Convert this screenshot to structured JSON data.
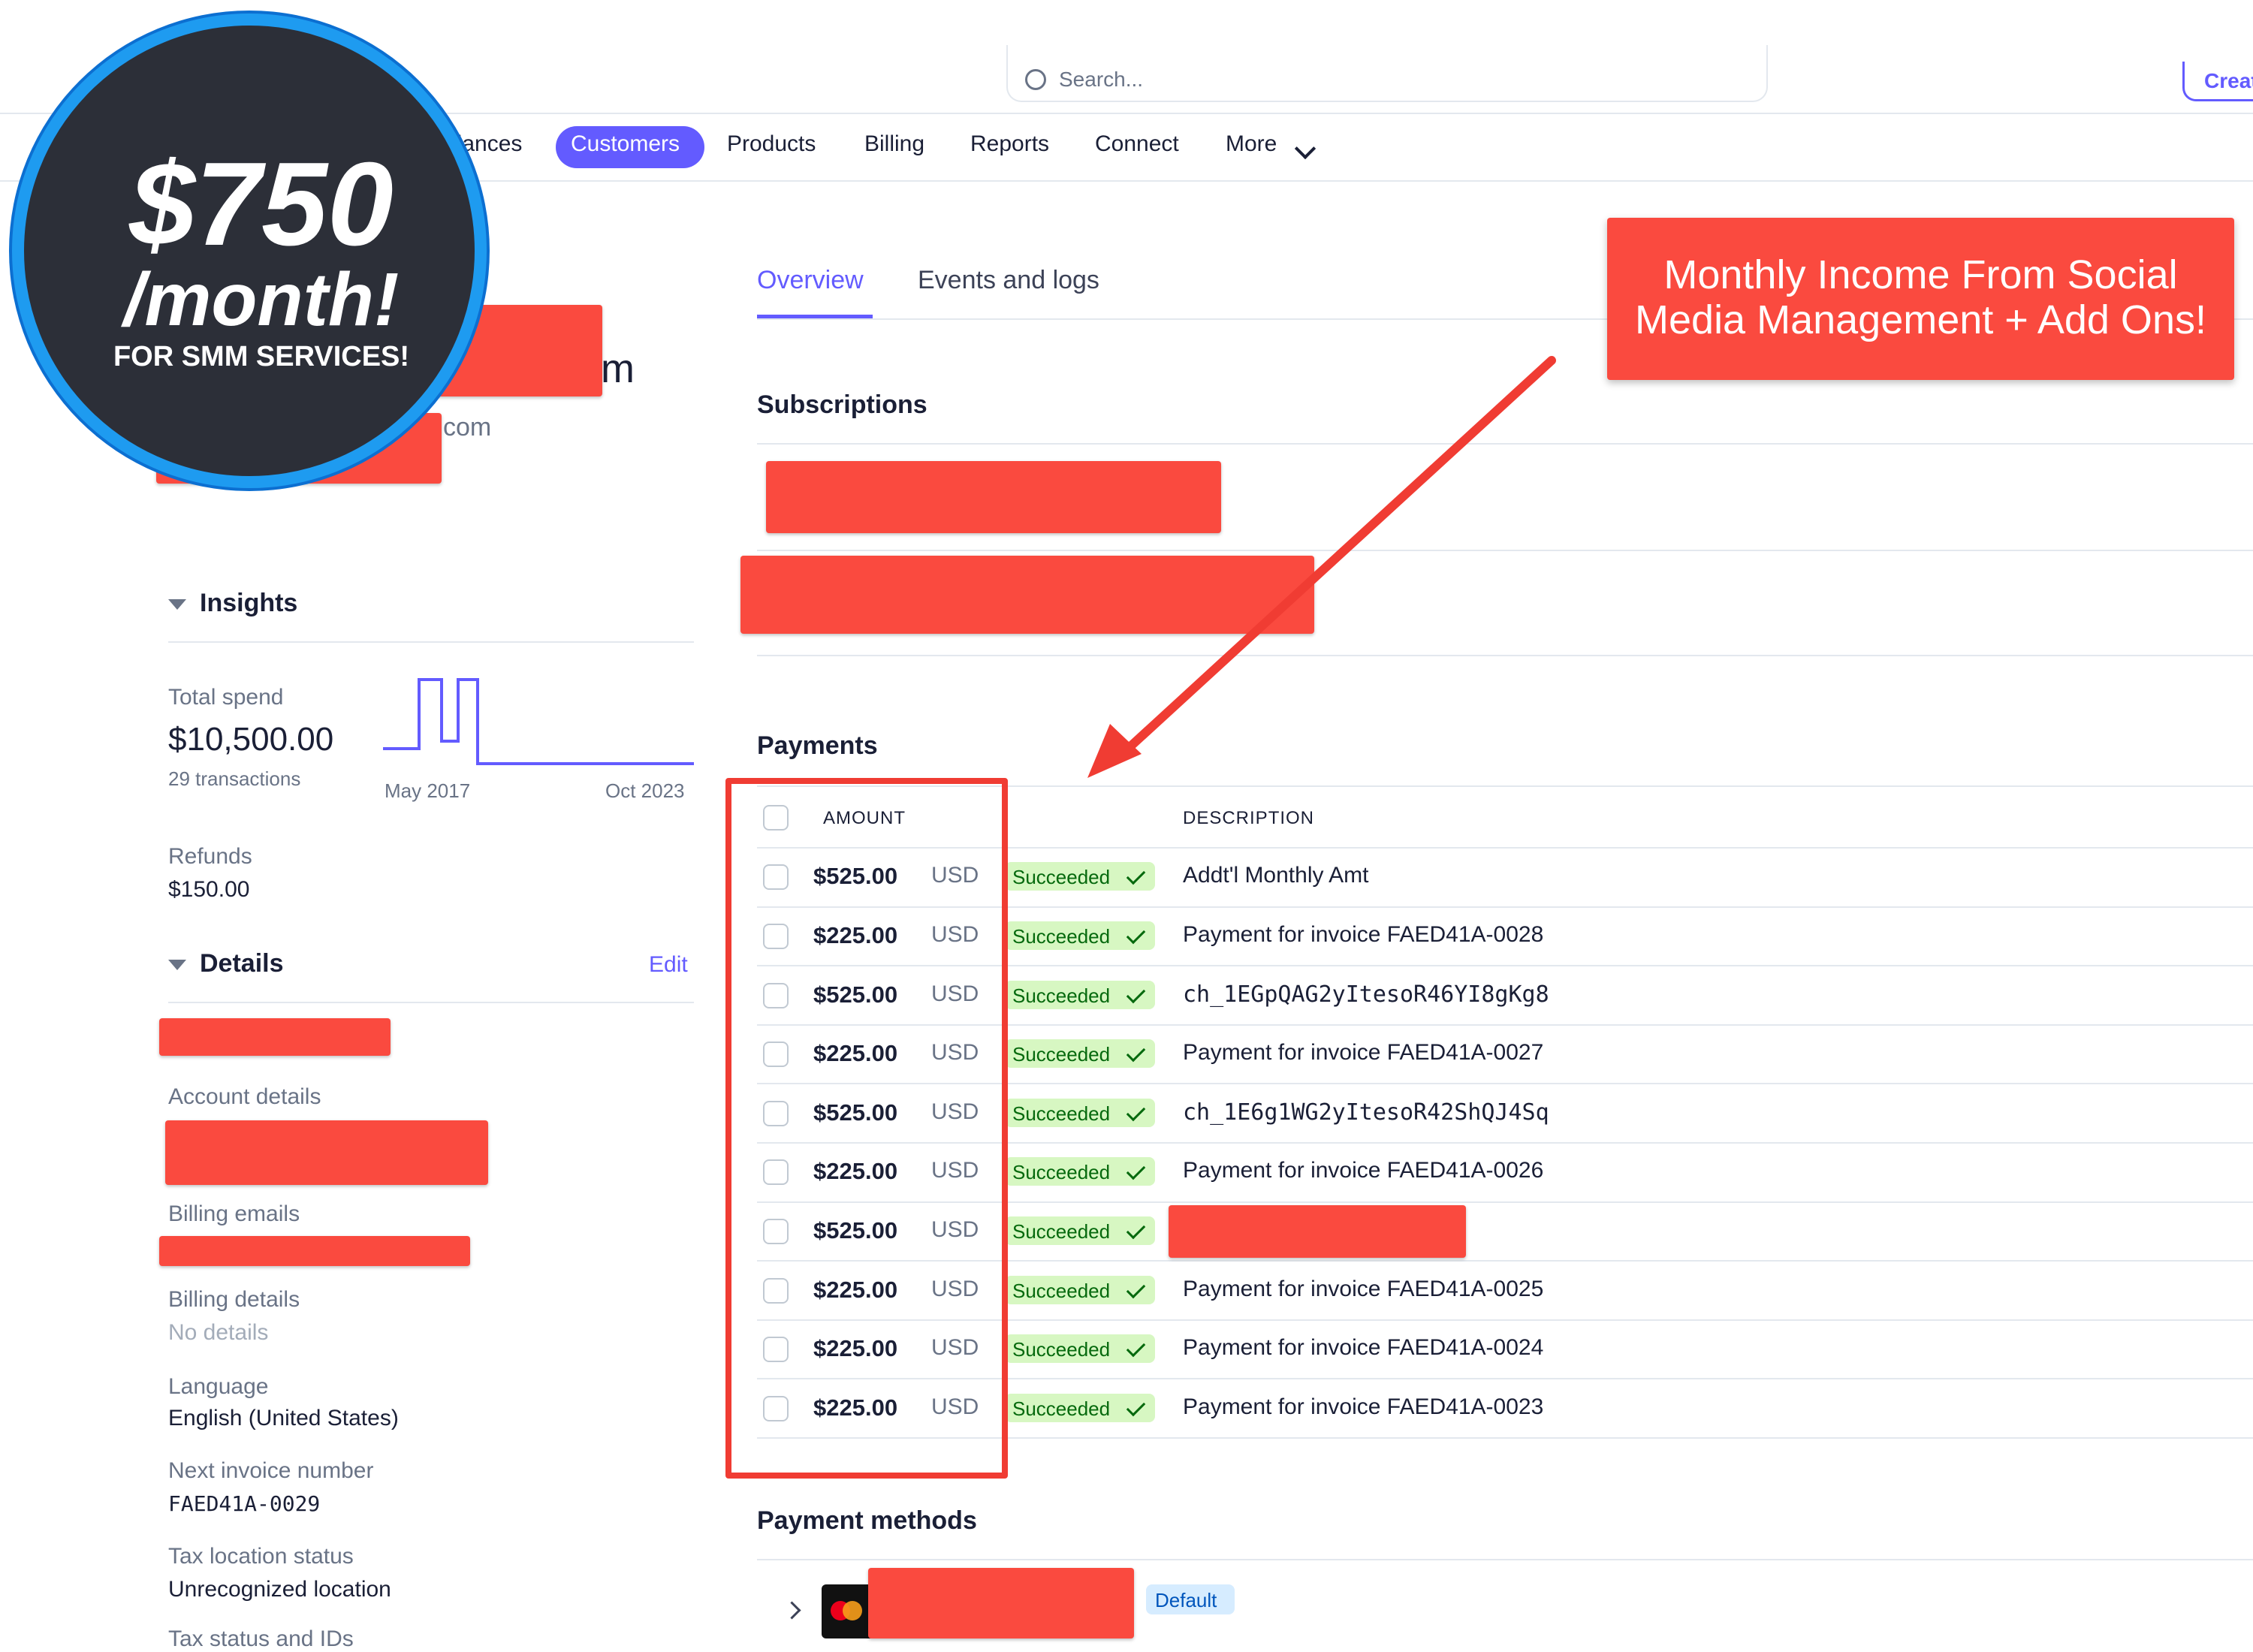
{
  "search": {
    "placeholder": "Search..."
  },
  "header": {
    "create_label": "Creat"
  },
  "nav": {
    "items": [
      {
        "label": "alances"
      },
      {
        "label": "Customers"
      },
      {
        "label": "Products"
      },
      {
        "label": "Billing"
      },
      {
        "label": "Reports"
      },
      {
        "label": "Connect"
      },
      {
        "label": "More"
      }
    ]
  },
  "promo": {
    "price": "$750",
    "period": "/month!",
    "subtitle": "FOR SMM SERVICES!"
  },
  "callout": {
    "text": "Monthly Income From Social Media Management + Add Ons!"
  },
  "customer": {
    "name_suffix": "m",
    "email_suffix": "com"
  },
  "tabs": [
    {
      "label": "Overview"
    },
    {
      "label": "Events and logs"
    }
  ],
  "insights": {
    "title": "Insights",
    "total_spend_label": "Total spend",
    "total_spend_value": "$10,500.00",
    "transactions": "29 transactions",
    "chart_start": "May 2017",
    "chart_end": "Oct 2023",
    "refunds_label": "Refunds",
    "refunds_value": "$150.00"
  },
  "details": {
    "title": "Details",
    "edit_label": "Edit",
    "account_details_label": "Account details",
    "billing_emails_label": "Billing emails",
    "billing_details_label": "Billing details",
    "billing_details_value": "No details",
    "language_label": "Language",
    "language_value": "English (United States)",
    "next_invoice_label": "Next invoice number",
    "next_invoice_value": "FAED41A-0029",
    "tax_location_label": "Tax location status",
    "tax_location_value": "Unrecognized location",
    "tax_status_label": "Tax status and IDs"
  },
  "subscriptions": {
    "title": "Subscriptions"
  },
  "payments": {
    "title": "Payments",
    "columns": {
      "amount": "AMOUNT",
      "description": "DESCRIPTION"
    },
    "rows": [
      {
        "amount": "$525.00",
        "currency": "USD",
        "status": "Succeeded",
        "description": "Addt'l Monthly Amt"
      },
      {
        "amount": "$225.00",
        "currency": "USD",
        "status": "Succeeded",
        "description": "Payment for invoice FAED41A-0028"
      },
      {
        "amount": "$525.00",
        "currency": "USD",
        "status": "Succeeded",
        "description": "ch_1EGpQAG2yItesoR46YI8gKg8"
      },
      {
        "amount": "$225.00",
        "currency": "USD",
        "status": "Succeeded",
        "description": "Payment for invoice FAED41A-0027"
      },
      {
        "amount": "$525.00",
        "currency": "USD",
        "status": "Succeeded",
        "description": "ch_1E6g1WG2yItesoR42ShQJ4Sq"
      },
      {
        "amount": "$225.00",
        "currency": "USD",
        "status": "Succeeded",
        "description": "Payment for invoice FAED41A-0026"
      },
      {
        "amount": "$525.00",
        "currency": "USD",
        "status": "Succeeded",
        "description": ""
      },
      {
        "amount": "$225.00",
        "currency": "USD",
        "status": "Succeeded",
        "description": "Payment for invoice FAED41A-0025"
      },
      {
        "amount": "$225.00",
        "currency": "USD",
        "status": "Succeeded",
        "description": "Payment for invoice FAED41A-0024"
      },
      {
        "amount": "$225.00",
        "currency": "USD",
        "status": "Succeeded",
        "description": "Payment for invoice FAED41A-0023"
      }
    ]
  },
  "payment_methods": {
    "title": "Payment methods",
    "default_label": "Default"
  },
  "colors": {
    "accent": "#635bff",
    "redaction": "#fa4a3f",
    "success_bg": "#d7f7c2",
    "success_text": "#05690d",
    "promo_ring": "#1e9bf0"
  }
}
